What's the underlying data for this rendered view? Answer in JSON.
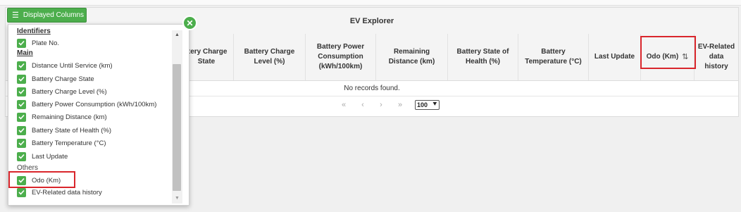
{
  "toolbar": {
    "displayed_columns_label": "Displayed Columns",
    "close_symbol": "✕"
  },
  "panel": {
    "title": "EV Explorer",
    "columns": [
      "ttery Charge State",
      "Battery Charge Level (%)",
      "Battery Power Consumption (kWh/100km)",
      "Remaining Distance (km)",
      "Battery State of Health (%)",
      "Battery Temperature (°C)",
      "Last Update",
      "Odo (Km)",
      "EV-Related data history"
    ],
    "sort_icon": "⇅",
    "empty_message": "No records found.",
    "pager": {
      "first": "«",
      "prev": "‹",
      "next": "›",
      "last": "»",
      "rows_per_page": "100"
    }
  },
  "column_picker": {
    "groups": [
      {
        "label": "Identifiers",
        "items": [
          "Plate No."
        ]
      },
      {
        "label": "Main",
        "items": [
          "Distance Until Service (km)",
          "Battery Charge State",
          "Battery Charge Level (%)",
          "Battery Power Consumption (kWh/100km)",
          "Remaining Distance (km)",
          "Battery State of Health (%)",
          "Battery Temperature (°C)",
          "Last Update"
        ]
      },
      {
        "label": "Others",
        "items": [
          "Odo (Km)",
          "EV-Related data history"
        ]
      }
    ]
  },
  "colors": {
    "accent": "#4cae4c",
    "highlight": "#d9262c"
  }
}
